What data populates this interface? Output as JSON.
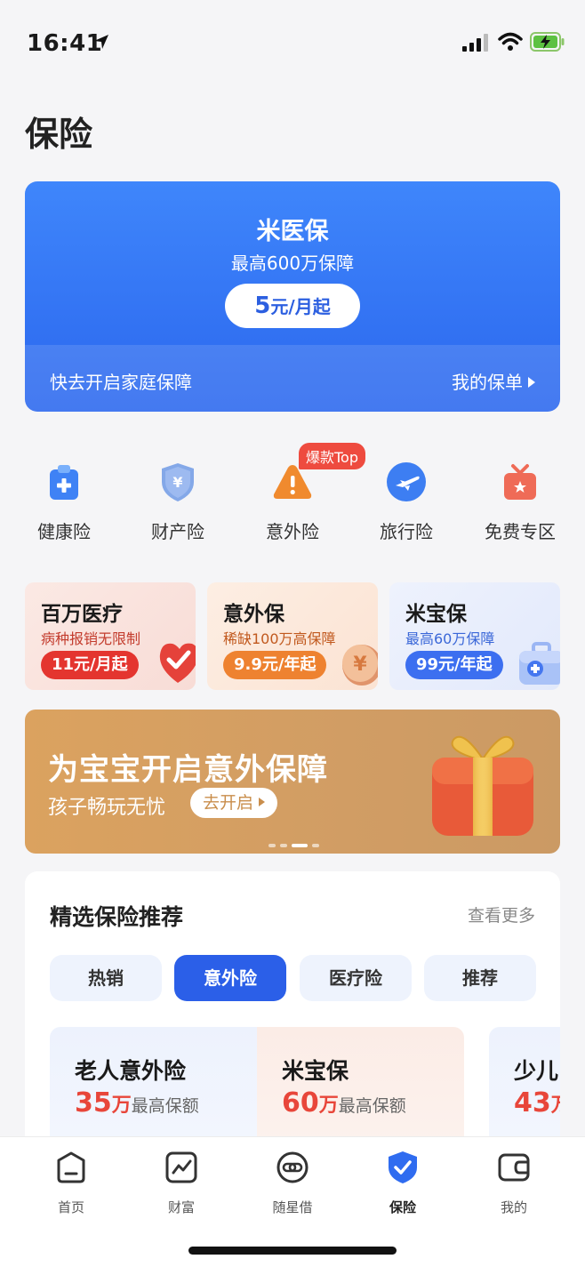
{
  "status_bar": {
    "time": "16:41"
  },
  "page": {
    "title": "保险"
  },
  "hero": {
    "title": "米医保",
    "subtitle": "最高600万保障",
    "price_big": "5",
    "price_small": "元/月起",
    "footer_left": "快去开启家庭保障",
    "footer_right": "我的保单"
  },
  "categories": {
    "hot_badge": "爆款Top",
    "items": [
      {
        "label": "健康险",
        "icon": "health-clipboard-icon"
      },
      {
        "label": "财产险",
        "icon": "property-shield-icon"
      },
      {
        "label": "意外险",
        "icon": "accident-warning-icon"
      },
      {
        "label": "旅行险",
        "icon": "travel-plane-icon"
      },
      {
        "label": "免费专区",
        "icon": "free-gift-icon"
      }
    ]
  },
  "products": [
    {
      "title": "百万医疗",
      "subtitle": "病种报销无限制",
      "price": "11元/月起",
      "accent": "#e4352f"
    },
    {
      "title": "意外保",
      "subtitle": "稀缺100万高保障",
      "price": "9.9元/年起",
      "accent": "#ee8230"
    },
    {
      "title": "米宝保",
      "subtitle": "最高60万保障",
      "price": "99元/年起",
      "accent": "#3c6ff0"
    }
  ],
  "banner": {
    "title": "为宝宝开启意外保障",
    "subtitle": "孩子畅玩无忧",
    "button": "去开启"
  },
  "recommend": {
    "title": "精选保险推荐",
    "more": "查看更多",
    "tabs": [
      "热销",
      "意外险",
      "医疗险",
      "推荐"
    ],
    "active_tab": 1,
    "cards": [
      {
        "title": "老人意外险",
        "num": "35",
        "unit": "万",
        "desc": "最高保额"
      },
      {
        "title": "米宝保",
        "num": "60",
        "unit": "万",
        "desc": "最高保额"
      },
      {
        "title": "少儿",
        "num": "43",
        "unit": "万",
        "desc": ""
      }
    ]
  },
  "tabbar": {
    "items": [
      {
        "label": "首页",
        "icon": "home-icon"
      },
      {
        "label": "财富",
        "icon": "wealth-chart-icon"
      },
      {
        "label": "随星借",
        "icon": "loan-link-icon"
      },
      {
        "label": "保险",
        "icon": "insurance-shield-icon"
      },
      {
        "label": "我的",
        "icon": "wallet-icon"
      }
    ],
    "active": 3
  },
  "colors": {
    "primary": "#2b5fe8",
    "accent_red": "#e8463a",
    "banner": "#d19d64"
  }
}
